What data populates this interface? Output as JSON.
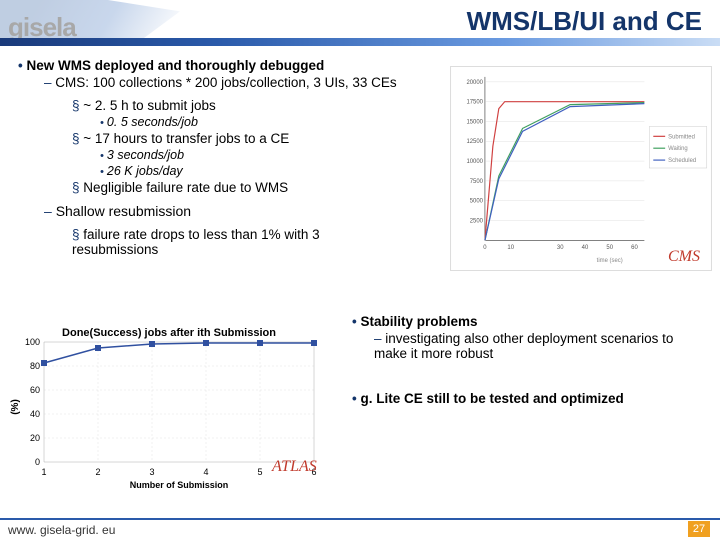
{
  "header": {
    "logo_text": "gisela",
    "title": "WMS/LB/UI and CE"
  },
  "bullets": {
    "b1": "New WMS deployed and thoroughly debugged",
    "b1_1": "CMS: 100 collections * 200 jobs/collection, 3 UIs, 33 CEs",
    "b1_1_1": "~ 2. 5 h to submit jobs",
    "b1_1_1_1": "0. 5 seconds/job",
    "b1_1_2": "~ 17 hours to transfer jobs to a CE",
    "b1_1_2_1": "3 seconds/job",
    "b1_1_2_2": "26 K jobs/day",
    "b1_1_3": "Negligible failure rate due to WMS",
    "b1_2": "Shallow resubmission",
    "b1_2_1": "failure rate drops to less than 1% with 3 resubmissions"
  },
  "right": {
    "r1": "Stability problems",
    "r1_1": "investigating also other deployment scenarios to make it more robust",
    "r2": "g. Lite CE still to be tested and optimized"
  },
  "labels": {
    "cms": "CMS",
    "atlas": "ATLAS"
  },
  "footer": {
    "url": "www. gisela-grid. eu",
    "page": "27"
  },
  "chart_data": [
    {
      "type": "line",
      "title": "",
      "xlabel": "time (sec)",
      "ylabel": "",
      "xlim": [
        0,
        65000
      ],
      "ylim": [
        0,
        20000
      ],
      "x_ticks": [
        0,
        10,
        30,
        40,
        50,
        60
      ],
      "y_ticks": [
        2500,
        5000,
        7500,
        10000,
        12500,
        15000,
        17500,
        20000
      ],
      "series": [
        {
          "name": "Submitted",
          "color": "#d04040",
          "x": [
            0,
            3000,
            5000,
            8000,
            65000
          ],
          "y": [
            0,
            12000,
            16500,
            17500,
            17500
          ]
        },
        {
          "name": "Waiting",
          "color": "#40a060",
          "x": [
            0,
            5000,
            15000,
            35000,
            65000
          ],
          "y": [
            0,
            8000,
            14000,
            17200,
            17400
          ]
        },
        {
          "name": "Scheduled",
          "color": "#4060c0",
          "x": [
            0,
            5000,
            15000,
            35000,
            65000
          ],
          "y": [
            0,
            7800,
            13800,
            17000,
            17300
          ]
        }
      ]
    },
    {
      "type": "line",
      "title": "Done(Success) jobs after ith Submission",
      "xlabel": "Number of Submission",
      "ylabel": "(%)",
      "xlim": [
        1,
        6
      ],
      "ylim": [
        0,
        100
      ],
      "x_ticks": [
        1,
        2,
        3,
        4,
        5,
        6
      ],
      "y_ticks": [
        0,
        20,
        40,
        60,
        80,
        100
      ],
      "series": [
        {
          "name": "",
          "color": "#3050a0",
          "x": [
            1,
            2,
            3,
            4,
            5,
            6
          ],
          "y": [
            82,
            95,
            98,
            99,
            99,
            99
          ]
        }
      ]
    }
  ]
}
